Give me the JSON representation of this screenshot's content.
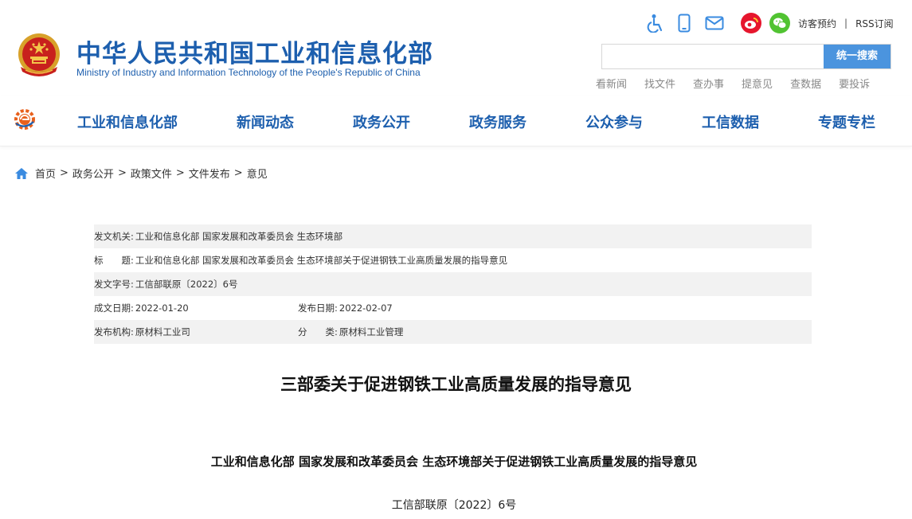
{
  "header": {
    "title": "中华人民共和国工业和信息化部",
    "subtitle": "Ministry of Industry and Information Technology of the People's Republic of China",
    "tools": {
      "icons": [
        "accessibility-icon",
        "mobile-icon",
        "mail-icon",
        "weibo-icon",
        "wechat-icon"
      ],
      "visitor_link": "访客预约",
      "separator": "|",
      "rss_link": "RSS订阅"
    },
    "search": {
      "placeholder": "",
      "button_label": "统一搜索"
    },
    "quick_links": [
      "看新闻",
      "找文件",
      "查办事",
      "提意见",
      "查数据",
      "要投诉"
    ]
  },
  "nav": {
    "items": [
      "工业和信息化部",
      "新闻动态",
      "政务公开",
      "政务服务",
      "公众参与",
      "工信数据",
      "专题专栏"
    ]
  },
  "breadcrumb": {
    "items": [
      "首页",
      "政务公开",
      "政策文件",
      "文件发布",
      "意见"
    ],
    "separator": ">"
  },
  "meta": {
    "issuer_label": "发文机关:",
    "issuer_value": "工业和信息化部 国家发展和改革委员会 生态环境部",
    "title_label": "标　　题:",
    "title_value": "工业和信息化部 国家发展和改革委员会 生态环境部关于促进钢铁工业高质量发展的指导意见",
    "docno_label": "发文字号:",
    "docno_value": "工信部联原〔2022〕6号",
    "created_label": "成文日期:",
    "created_value": "2022-01-20",
    "published_label": "发布日期:",
    "published_value": "2022-02-07",
    "org_label": "发布机构:",
    "org_value": "原材料工业司",
    "category_label": "分　　类:",
    "category_value": "原材料工业管理"
  },
  "article": {
    "title": "三部委关于促进钢铁工业高质量发展的指导意见",
    "subhead": "工业和信息化部 国家发展和改革委员会 生态环境部关于促进钢铁工业高质量发展的指导意见",
    "doc_number": "工信部联原〔2022〕6号"
  },
  "colors": {
    "brand_blue": "#1d5fae",
    "search_button": "#4b94de",
    "meta_shade": "#f2f2f2",
    "weibo": "#e6162d",
    "wechat": "#51c332"
  }
}
